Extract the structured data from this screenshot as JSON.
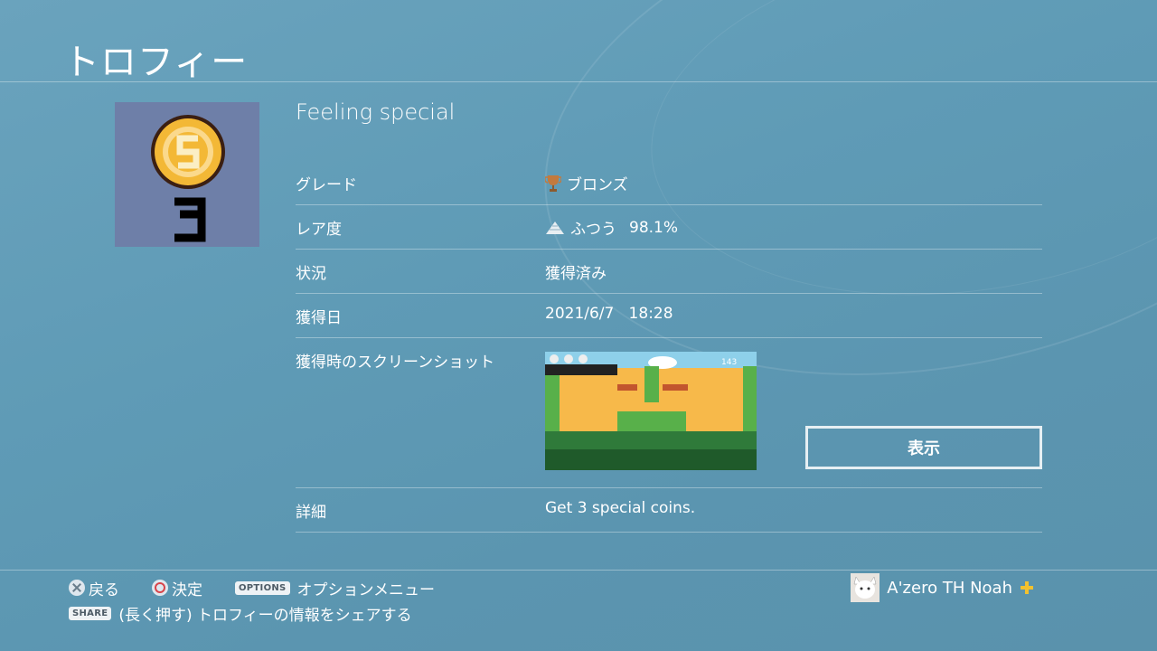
{
  "page_title": "トロフィー",
  "trophy": {
    "name": "Feeling special",
    "icon": "pixel-coin-3-icon",
    "rows": {
      "grade": {
        "label": "グレード",
        "value": "ブロンズ",
        "icon": "bronze-trophy-icon"
      },
      "rarity": {
        "label": "レア度",
        "value": "ふつう",
        "percent": "98.1%",
        "icon": "rarity-pyramid-icon"
      },
      "status": {
        "label": "状況",
        "value": "獲得済み"
      },
      "date": {
        "label": "獲得日",
        "value": "2021/6/7   18:28"
      },
      "screenshot": {
        "label": "獲得時のスクリーンショット",
        "button": "表示"
      },
      "detail": {
        "label": "詳細",
        "value": "Get 3 special coins."
      }
    }
  },
  "footer": {
    "back": "戻る",
    "confirm": "決定",
    "options_key": "OPTIONS",
    "options_label": "オプションメニュー",
    "share_key": "SHARE",
    "share_label": "(長く押す) トロフィーの情報をシェアする"
  },
  "user": {
    "name": "A'zero TH Noah",
    "plus_icon": "ps-plus-icon"
  },
  "colors": {
    "background": "#5f9bb6",
    "coin": "#f3b836",
    "icon_bg": "#6e7fa8"
  }
}
